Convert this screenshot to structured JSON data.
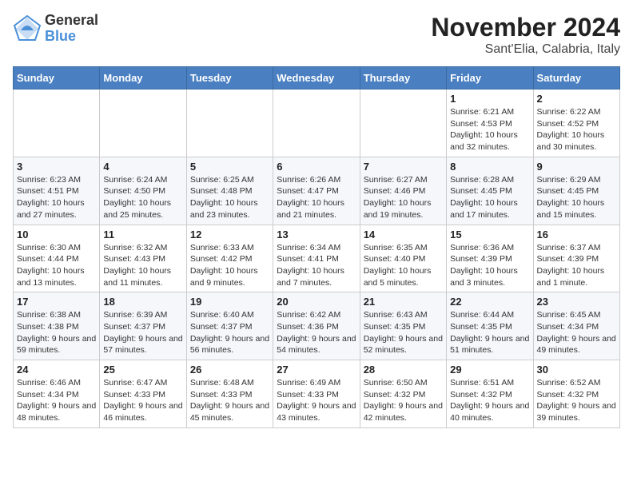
{
  "logo": {
    "general": "General",
    "blue": "Blue"
  },
  "title": "November 2024",
  "subtitle": "Sant'Elia, Calabria, Italy",
  "days_of_week": [
    "Sunday",
    "Monday",
    "Tuesday",
    "Wednesday",
    "Thursday",
    "Friday",
    "Saturday"
  ],
  "weeks": [
    [
      {
        "day": "",
        "info": ""
      },
      {
        "day": "",
        "info": ""
      },
      {
        "day": "",
        "info": ""
      },
      {
        "day": "",
        "info": ""
      },
      {
        "day": "",
        "info": ""
      },
      {
        "day": "1",
        "info": "Sunrise: 6:21 AM\nSunset: 4:53 PM\nDaylight: 10 hours and 32 minutes."
      },
      {
        "day": "2",
        "info": "Sunrise: 6:22 AM\nSunset: 4:52 PM\nDaylight: 10 hours and 30 minutes."
      }
    ],
    [
      {
        "day": "3",
        "info": "Sunrise: 6:23 AM\nSunset: 4:51 PM\nDaylight: 10 hours and 27 minutes."
      },
      {
        "day": "4",
        "info": "Sunrise: 6:24 AM\nSunset: 4:50 PM\nDaylight: 10 hours and 25 minutes."
      },
      {
        "day": "5",
        "info": "Sunrise: 6:25 AM\nSunset: 4:48 PM\nDaylight: 10 hours and 23 minutes."
      },
      {
        "day": "6",
        "info": "Sunrise: 6:26 AM\nSunset: 4:47 PM\nDaylight: 10 hours and 21 minutes."
      },
      {
        "day": "7",
        "info": "Sunrise: 6:27 AM\nSunset: 4:46 PM\nDaylight: 10 hours and 19 minutes."
      },
      {
        "day": "8",
        "info": "Sunrise: 6:28 AM\nSunset: 4:45 PM\nDaylight: 10 hours and 17 minutes."
      },
      {
        "day": "9",
        "info": "Sunrise: 6:29 AM\nSunset: 4:45 PM\nDaylight: 10 hours and 15 minutes."
      }
    ],
    [
      {
        "day": "10",
        "info": "Sunrise: 6:30 AM\nSunset: 4:44 PM\nDaylight: 10 hours and 13 minutes."
      },
      {
        "day": "11",
        "info": "Sunrise: 6:32 AM\nSunset: 4:43 PM\nDaylight: 10 hours and 11 minutes."
      },
      {
        "day": "12",
        "info": "Sunrise: 6:33 AM\nSunset: 4:42 PM\nDaylight: 10 hours and 9 minutes."
      },
      {
        "day": "13",
        "info": "Sunrise: 6:34 AM\nSunset: 4:41 PM\nDaylight: 10 hours and 7 minutes."
      },
      {
        "day": "14",
        "info": "Sunrise: 6:35 AM\nSunset: 4:40 PM\nDaylight: 10 hours and 5 minutes."
      },
      {
        "day": "15",
        "info": "Sunrise: 6:36 AM\nSunset: 4:39 PM\nDaylight: 10 hours and 3 minutes."
      },
      {
        "day": "16",
        "info": "Sunrise: 6:37 AM\nSunset: 4:39 PM\nDaylight: 10 hours and 1 minute."
      }
    ],
    [
      {
        "day": "17",
        "info": "Sunrise: 6:38 AM\nSunset: 4:38 PM\nDaylight: 9 hours and 59 minutes."
      },
      {
        "day": "18",
        "info": "Sunrise: 6:39 AM\nSunset: 4:37 PM\nDaylight: 9 hours and 57 minutes."
      },
      {
        "day": "19",
        "info": "Sunrise: 6:40 AM\nSunset: 4:37 PM\nDaylight: 9 hours and 56 minutes."
      },
      {
        "day": "20",
        "info": "Sunrise: 6:42 AM\nSunset: 4:36 PM\nDaylight: 9 hours and 54 minutes."
      },
      {
        "day": "21",
        "info": "Sunrise: 6:43 AM\nSunset: 4:35 PM\nDaylight: 9 hours and 52 minutes."
      },
      {
        "day": "22",
        "info": "Sunrise: 6:44 AM\nSunset: 4:35 PM\nDaylight: 9 hours and 51 minutes."
      },
      {
        "day": "23",
        "info": "Sunrise: 6:45 AM\nSunset: 4:34 PM\nDaylight: 9 hours and 49 minutes."
      }
    ],
    [
      {
        "day": "24",
        "info": "Sunrise: 6:46 AM\nSunset: 4:34 PM\nDaylight: 9 hours and 48 minutes."
      },
      {
        "day": "25",
        "info": "Sunrise: 6:47 AM\nSunset: 4:33 PM\nDaylight: 9 hours and 46 minutes."
      },
      {
        "day": "26",
        "info": "Sunrise: 6:48 AM\nSunset: 4:33 PM\nDaylight: 9 hours and 45 minutes."
      },
      {
        "day": "27",
        "info": "Sunrise: 6:49 AM\nSunset: 4:33 PM\nDaylight: 9 hours and 43 minutes."
      },
      {
        "day": "28",
        "info": "Sunrise: 6:50 AM\nSunset: 4:32 PM\nDaylight: 9 hours and 42 minutes."
      },
      {
        "day": "29",
        "info": "Sunrise: 6:51 AM\nSunset: 4:32 PM\nDaylight: 9 hours and 40 minutes."
      },
      {
        "day": "30",
        "info": "Sunrise: 6:52 AM\nSunset: 4:32 PM\nDaylight: 9 hours and 39 minutes."
      }
    ]
  ]
}
